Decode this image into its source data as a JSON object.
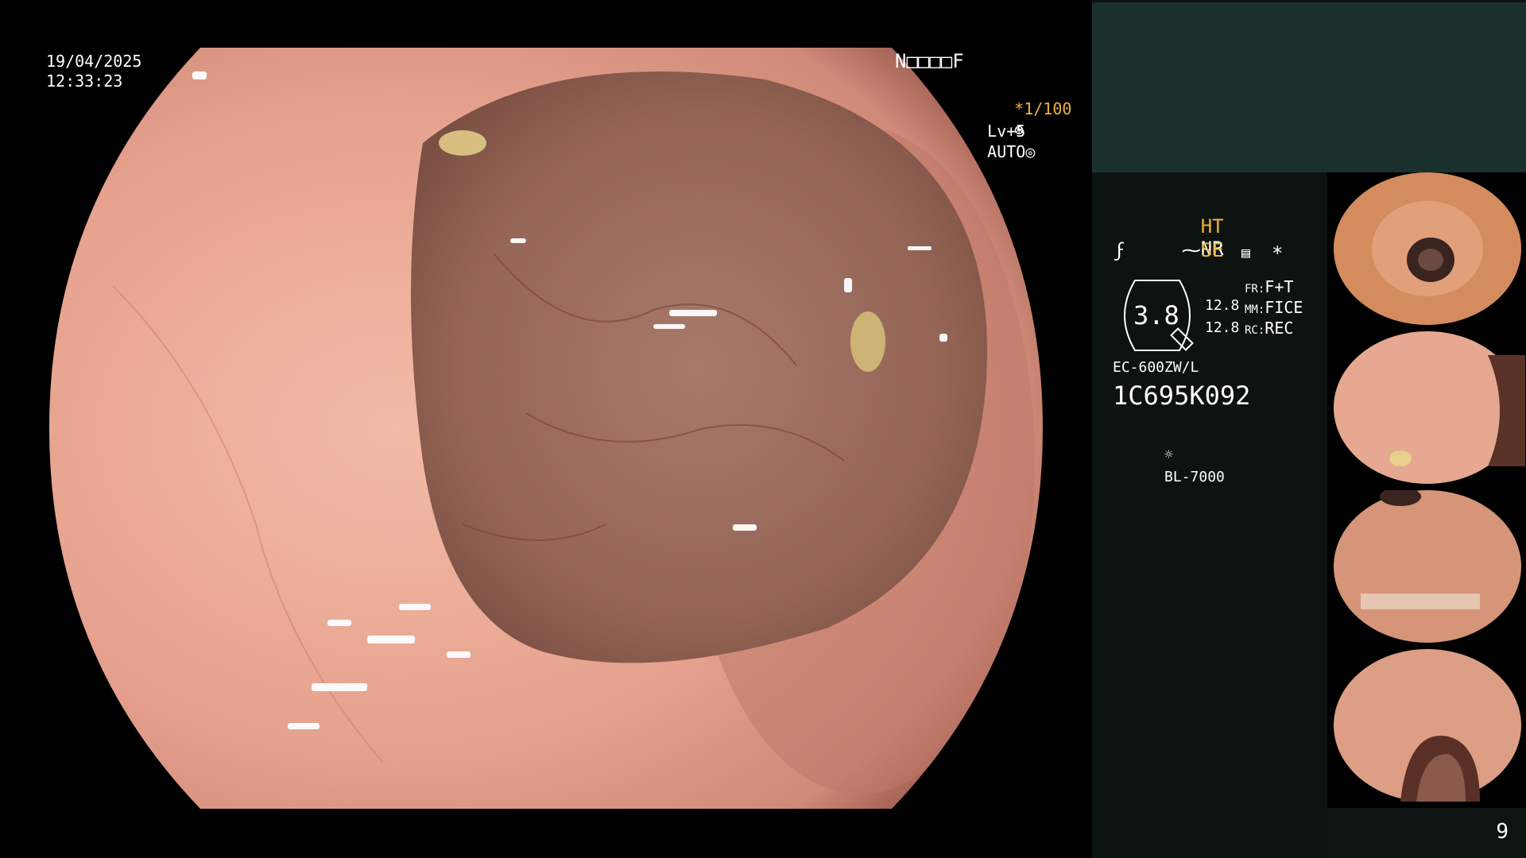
{
  "overlay": {
    "date": "19/04/2025",
    "time": "12:33:23",
    "patient_mask": "N□□□□F",
    "shutter": "*1/100",
    "shutter_icon": "aperture-icon",
    "level": "Lv+5",
    "exposure_mode": "AUTO",
    "exposure_icon": "iris-icon"
  },
  "panel": {
    "ht": "HT",
    "nr": "NR",
    "se": "SE",
    "se_icon": "structure-icon",
    "color_icon": "color-enhance-icon",
    "settings_icon": "menu-settings-icon",
    "star": "*",
    "zoom_value": "3.8",
    "zoom_top": "12.8",
    "zoom_bottom": "12.8",
    "fr_label": "FR:",
    "fr_value": "F+T",
    "mm_label": "MM:",
    "mm_value": "FICE",
    "rc_label": "RC:",
    "rc_value": "REC",
    "scope_model": "EC-600ZW/L",
    "serial": "1C695K092",
    "light_source": "BL-7000",
    "light_icon": "lightsource-icon",
    "page_number": "9"
  },
  "colors": {
    "accent_orange": "#f0b23a",
    "panel_dark": "#0c1311",
    "panel_top": "#1a302c",
    "mucosa": "#e8a490"
  }
}
